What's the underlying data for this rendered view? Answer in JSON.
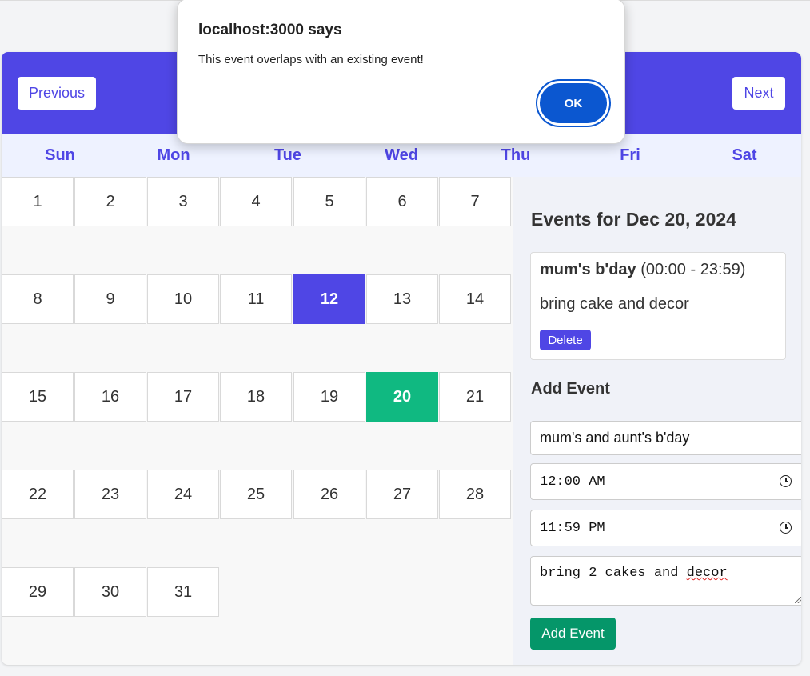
{
  "nav": {
    "previous_label": "Previous",
    "next_label": "Next"
  },
  "weekdays": [
    "Sun",
    "Mon",
    "Tue",
    "Wed",
    "Thu",
    "Fri",
    "Sat"
  ],
  "days": [
    "1",
    "2",
    "3",
    "4",
    "5",
    "6",
    "7",
    "8",
    "9",
    "10",
    "11",
    "12",
    "13",
    "14",
    "15",
    "16",
    "17",
    "18",
    "19",
    "20",
    "21",
    "22",
    "23",
    "24",
    "25",
    "26",
    "27",
    "28",
    "29",
    "30",
    "31"
  ],
  "highlighted_day": "12",
  "selected_day": "20",
  "colors": {
    "accent": "#4f46e5",
    "selected": "#10b981",
    "add_button": "#059669",
    "dialog_button": "#0b57d0"
  },
  "panel": {
    "title": "Events for Dec 20, 2024",
    "event": {
      "name": "mum's b'day",
      "time": "(00:00 - 23:59)",
      "description": "bring cake and decor",
      "delete_label": "Delete"
    },
    "add_title": "Add Event",
    "form": {
      "title_value": "mum's and aunt's b'day",
      "start_time": "12:00 AM",
      "end_time": "11:59 PM",
      "description_value": "bring 2 cakes and",
      "description_misspelled": "decor",
      "add_label": "Add Event"
    }
  },
  "dialog": {
    "title": "localhost:3000 says",
    "message": "This event overlaps with an existing event!",
    "ok_label": "OK"
  }
}
